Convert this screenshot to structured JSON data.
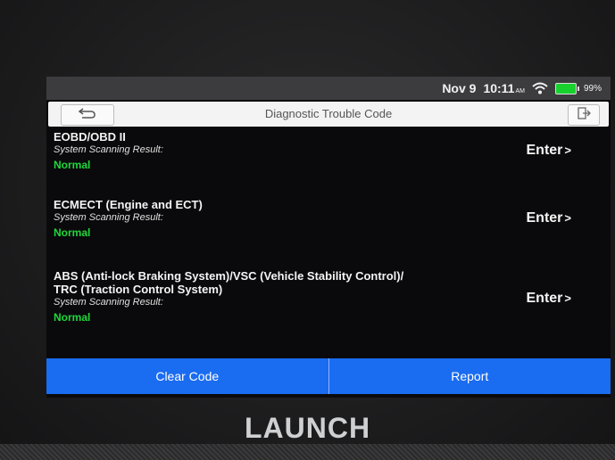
{
  "status_bar": {
    "date": "Nov 9",
    "time": "10:11",
    "ampm": "AM",
    "battery": "99%",
    "battery_color": "#18d12f"
  },
  "header": {
    "title": "Diagnostic Trouble Code",
    "back_icon": "back-arrow-icon",
    "exit_icon": "exit-icon"
  },
  "systems": [
    {
      "name": "EOBD/OBD II",
      "subtitle": "System Scanning Result:",
      "status": "Normal",
      "action": "Enter"
    },
    {
      "name": "ECMECT (Engine and ECT)",
      "subtitle": "System Scanning Result:",
      "status": "Normal",
      "action": "Enter"
    },
    {
      "name_line1": "ABS (Anti-lock Braking System)/VSC (Vehicle Stability Control)/",
      "name_line2": "TRC (Traction Control System)",
      "subtitle": "System Scanning Result:",
      "status": "Normal",
      "action": "Enter"
    }
  ],
  "footer": {
    "clear_code": "Clear Code",
    "report": "Report",
    "accent": "#1a6cf0"
  },
  "brand": "LAUNCH",
  "colors": {
    "status_ok": "#1fd83a"
  }
}
